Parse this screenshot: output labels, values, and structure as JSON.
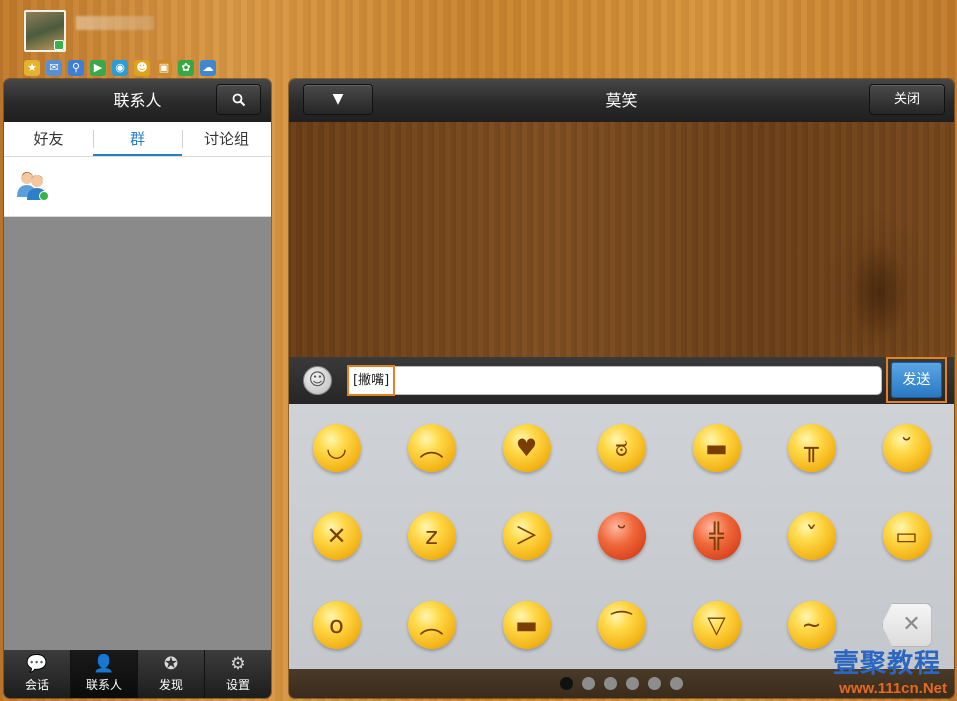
{
  "top": {
    "username": "",
    "app_icons": [
      {
        "icon": "star-icon",
        "glyph": "★",
        "color": "#e2b230"
      },
      {
        "icon": "mail-icon",
        "glyph": "✉",
        "color": "#5a8fd0"
      },
      {
        "icon": "search-app-icon",
        "glyph": "⚲",
        "color": "#3c7fd4"
      },
      {
        "icon": "video-icon",
        "glyph": "▶",
        "color": "#3aa84a"
      },
      {
        "icon": "browser-icon",
        "glyph": "◉",
        "color": "#2d9bd6"
      },
      {
        "icon": "pet-icon",
        "glyph": "☻",
        "color": "#e0a21a"
      },
      {
        "icon": "wallet-icon",
        "glyph": "▣",
        "color": "#d08a2a"
      },
      {
        "icon": "clover-icon",
        "glyph": "✿",
        "color": "#36a845"
      },
      {
        "icon": "cloud-icon",
        "glyph": "☁",
        "color": "#3f88d0"
      }
    ]
  },
  "contacts": {
    "title": "联系人",
    "tabs": [
      {
        "label": "好友",
        "active": false
      },
      {
        "label": "群",
        "active": true
      },
      {
        "label": "讨论组",
        "active": false
      }
    ]
  },
  "bottom_nav": [
    {
      "label": "会话",
      "icon": "chat-bubble-icon",
      "glyph": "💬",
      "active": false
    },
    {
      "label": "联系人",
      "icon": "contact-person-icon",
      "glyph": "👤",
      "active": true
    },
    {
      "label": "发现",
      "icon": "discover-star-icon",
      "glyph": "✪",
      "active": false
    },
    {
      "label": "设置",
      "icon": "settings-gear-icon",
      "glyph": "⚙",
      "active": false
    }
  ],
  "chat": {
    "title": "莫笑",
    "dropdown_glyph": "▼",
    "close_label": "关闭",
    "input_value": "[撇嘴]",
    "send_label": "发送"
  },
  "emoji_rows": [
    [
      {
        "name": "smile-emoji",
        "glyph": "◡",
        "tone": "yellow"
      },
      {
        "name": "pout-emoji",
        "glyph": "︵",
        "tone": "yellow"
      },
      {
        "name": "heart-eyes-emoji",
        "glyph": "♥",
        "tone": "yellow"
      },
      {
        "name": "stare-emoji",
        "glyph": "ಠ",
        "tone": "yellow"
      },
      {
        "name": "cool-sunglasses-emoji",
        "glyph": "▬",
        "tone": "yellow"
      },
      {
        "name": "crying-emoji",
        "glyph": "╥",
        "tone": "yellow"
      },
      {
        "name": "shy-emoji",
        "glyph": "˘",
        "tone": "yellow"
      }
    ],
    [
      {
        "name": "shut-up-emoji",
        "glyph": "✕",
        "tone": "yellow"
      },
      {
        "name": "sleep-emoji",
        "glyph": "z",
        "tone": "yellow"
      },
      {
        "name": "sob-emoji",
        "glyph": "＞",
        "tone": "yellow"
      },
      {
        "name": "embarrassed-emoji",
        "glyph": "˘",
        "tone": "red"
      },
      {
        "name": "angry-emoji",
        "glyph": "╬",
        "tone": "red"
      },
      {
        "name": "tongue-wink-emoji",
        "glyph": "ˇ",
        "tone": "yellow"
      },
      {
        "name": "grin-emoji",
        "glyph": "▭",
        "tone": "yellow"
      }
    ],
    [
      {
        "name": "surprised-emoji",
        "glyph": "o",
        "tone": "yellow"
      },
      {
        "name": "sad-emoji",
        "glyph": "︵",
        "tone": "yellow"
      },
      {
        "name": "sunglasses-emoji",
        "glyph": "▬",
        "tone": "yellow"
      },
      {
        "name": "sweat-emoji",
        "glyph": "⁀",
        "tone": "yellow"
      },
      {
        "name": "laugh-emoji",
        "glyph": "▽",
        "tone": "yellow"
      },
      {
        "name": "vomit-emoji",
        "glyph": "~",
        "tone": "yellow"
      },
      {
        "name": "delete-key",
        "glyph": "✕",
        "tone": "delete"
      }
    ]
  ],
  "pager": {
    "count": 6,
    "active_index": 0
  },
  "watermark": {
    "text_cn": "壹聚教程",
    "url": "www.111cn.Net"
  }
}
